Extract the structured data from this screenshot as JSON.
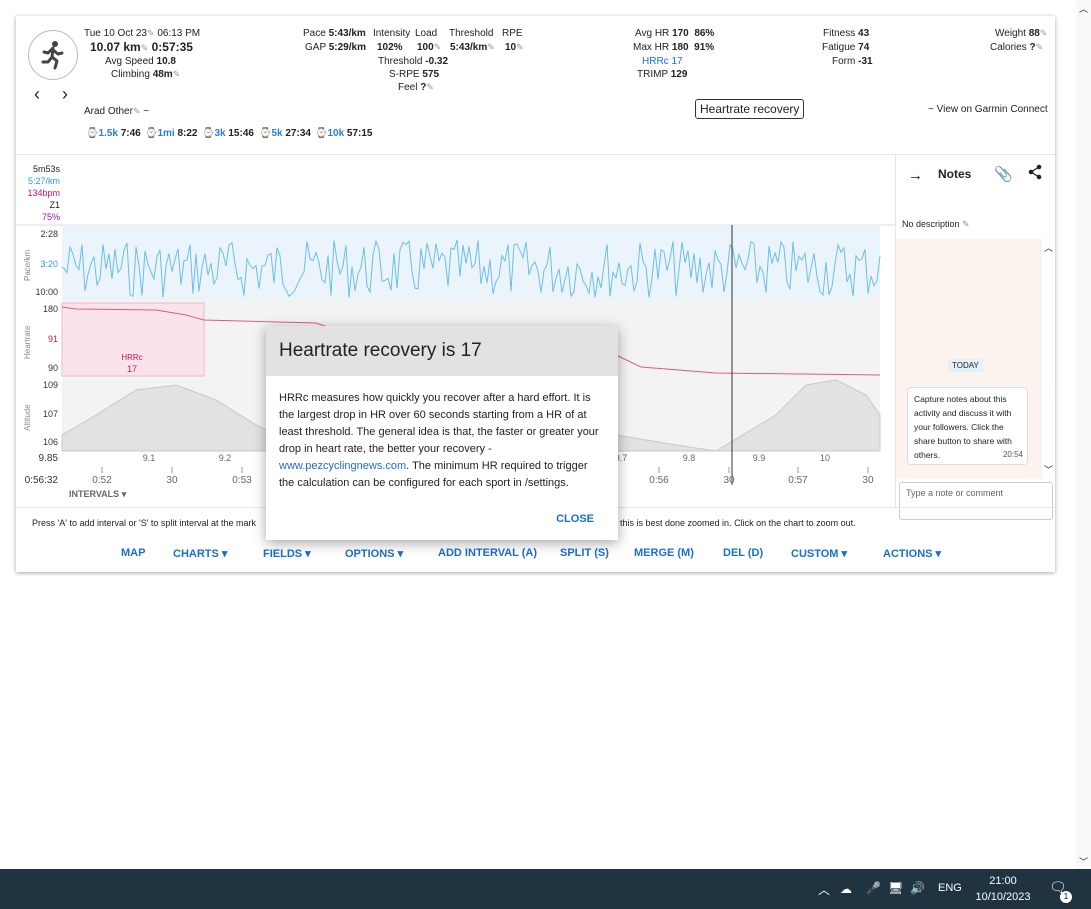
{
  "header": {
    "date": "Tue 10 Oct 23",
    "time": "06:13 PM",
    "distance": "10.07 km",
    "duration": "0:57:35",
    "avg_speed_label": "Avg Speed",
    "avg_speed": "10.8",
    "climbing_label": "Climbing",
    "climbing": "48m",
    "pace_label": "Pace",
    "pace": "5:43/km",
    "gap_label": "GAP",
    "gap": "5:29/km",
    "intensity_label": "Intensity",
    "intensity": "102%",
    "load_label": "Load",
    "load": "100",
    "threshold_label": "Threshold",
    "threshold": "5:43/km",
    "rpe_label": "RPE",
    "rpe": "10",
    "threshold2_label": "Threshold",
    "threshold2": "-0.32",
    "srpe_label": "S-RPE",
    "srpe": "575",
    "feel_label": "Feel",
    "feel": "?",
    "avg_hr_label": "Avg HR",
    "avg_hr": "170",
    "avg_hr_pct": "86%",
    "max_hr_label": "Max HR",
    "max_hr": "180",
    "max_hr_pct": "91%",
    "hrrc_label": "HRRc",
    "hrrc": "17",
    "trimp_label": "TRIMP",
    "trimp": "129",
    "fitness_label": "Fitness",
    "fitness": "43",
    "fatigue_label": "Fatigue",
    "fatigue": "74",
    "form_label": "Form",
    "form": "-31",
    "weight_label": "Weight",
    "weight": "88",
    "calories_label": "Calories",
    "calories": "?",
    "name": "Arad Other",
    "name_extra": "~",
    "garmin_link": "~ View on Garmin Connect",
    "tooltip": "Heartrate recovery"
  },
  "laps": [
    {
      "label": "1.5k",
      "value": "7:46"
    },
    {
      "label": "1mi",
      "value": "8:22"
    },
    {
      "label": "3k",
      "value": "15:46"
    },
    {
      "label": "5k",
      "value": "27:34"
    },
    {
      "label": "10k",
      "value": "57:15"
    }
  ],
  "cursor_readout": {
    "time": "5m53s",
    "pace": "5:27/km",
    "hr": "134bpm",
    "zone": "Z1",
    "pct": "75%"
  },
  "chart_data": {
    "type": "line",
    "pace": {
      "ylabel": "Pace/km",
      "ticks": [
        "2:28",
        "3:20",
        "10:00"
      ]
    },
    "heartrate": {
      "ylabel": "Heartrate",
      "ticks": [
        "180",
        "91",
        "90"
      ],
      "hrrc_label": "HRRc",
      "hrrc_value": "17"
    },
    "altitude": {
      "ylabel": "Altitude",
      "ticks": [
        "109",
        "107",
        "106"
      ]
    },
    "distance_ticks": [
      "9.85",
      "9.1",
      "9.2",
      "9.7",
      "9.8",
      "9.9",
      "10"
    ],
    "time_ticks": [
      "0:56:32",
      "0:52",
      "30",
      "0:53",
      "0:56",
      "30",
      "0:57",
      "30"
    ],
    "intervals_label": "INTERVALS"
  },
  "hint_text_left": "Press 'A' to add interval or 'S' to split interval at the mark",
  "hint_text_right": "this is best done zoomed in. Click on the chart to zoom out.",
  "buttons": [
    "MAP",
    "CHARTS",
    "FIELDS",
    "OPTIONS",
    "ADD INTERVAL (A)",
    "SPLIT (S)",
    "MERGE (M)",
    "DEL (D)",
    "CUSTOM",
    "ACTIONS"
  ],
  "notes": {
    "title": "Notes",
    "no_description": "No description",
    "today": "TODAY",
    "message": "Capture notes about this activity and discuss it with your followers. Click the share button to share with others.",
    "message_time": "20:54",
    "placeholder": "Type a note or comment"
  },
  "dialog": {
    "title": "Heartrate recovery is 17",
    "body_1": "HRRc measures how quickly you recover after a hard effort. It is the largest drop in HR over 60 seconds starting from a HR of at least threshold. The general idea is that, the faster or greater your drop in heart rate, the better your recovery -",
    "link": "www.pezcyclingnews.com",
    "body_2": ". The minimum HR required to trigger the calculation can be configured for each sport in /settings.",
    "close": "CLOSE"
  },
  "taskbar": {
    "lang": "ENG",
    "time": "21:00",
    "date": "10/10/2023",
    "notif": "1"
  }
}
